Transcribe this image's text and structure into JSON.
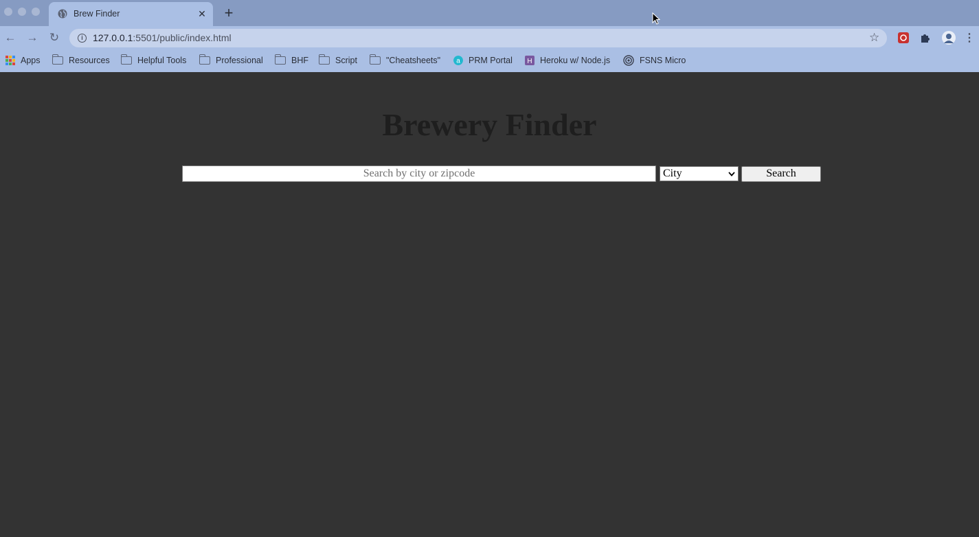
{
  "browser": {
    "tab_title": "Brew Finder",
    "tab_close": "✕",
    "new_tab": "+",
    "url_host": "127.0.0.1",
    "url_rest": ":5501/public/index.html",
    "bookmarks": [
      {
        "label": "Apps",
        "icon": "apps-grid-icon"
      },
      {
        "label": "Resources",
        "icon": "folder-icon"
      },
      {
        "label": "Helpful Tools",
        "icon": "folder-icon"
      },
      {
        "label": "Professional",
        "icon": "folder-icon"
      },
      {
        "label": "BHF",
        "icon": "folder-icon"
      },
      {
        "label": "Script",
        "icon": "folder-icon"
      },
      {
        "label": "\"Cheatsheets\"",
        "icon": "folder-icon"
      },
      {
        "label": "PRM Portal",
        "icon": "prm-logo-icon"
      },
      {
        "label": "Heroku w/ Node.js",
        "icon": "heroku-logo-icon"
      },
      {
        "label": "FSNS Micro",
        "icon": "fsns-logo-icon"
      }
    ]
  },
  "page": {
    "title": "Brewery Finder",
    "search_placeholder": "Search by city or zipcode",
    "select_value": "City",
    "search_button": "Search"
  },
  "colors": {
    "page_background": "#333333",
    "title_color": "#1e1e1e",
    "chrome_accent": "#aabfe4"
  }
}
